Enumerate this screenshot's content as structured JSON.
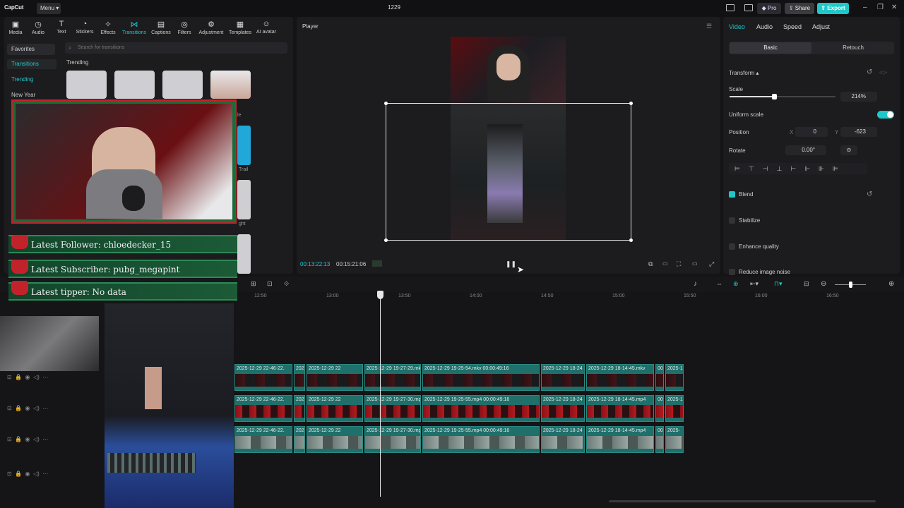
{
  "app": {
    "name": "CapCut",
    "menu_label": "Menu",
    "project_title": "1229"
  },
  "topbar": {
    "pro_label": "Pro",
    "share_label": "Share",
    "export_label": "Export"
  },
  "toolbar": {
    "items": [
      {
        "label": "Media",
        "icon": "media-icon"
      },
      {
        "label": "Audio",
        "icon": "audio-icon"
      },
      {
        "label": "Text",
        "icon": "text-icon"
      },
      {
        "label": "Stickers",
        "icon": "stickers-icon"
      },
      {
        "label": "Effects",
        "icon": "effects-icon"
      },
      {
        "label": "Transitions",
        "icon": "transitions-icon"
      },
      {
        "label": "Captions",
        "icon": "captions-icon"
      },
      {
        "label": "Filters",
        "icon": "filters-icon"
      },
      {
        "label": "Adjustment",
        "icon": "adjustment-icon"
      },
      {
        "label": "Templates",
        "icon": "templates-icon"
      },
      {
        "label": "AI avatar",
        "icon": "ai-avatar-icon"
      }
    ],
    "active_index": 5
  },
  "library": {
    "favorites": "Favorites",
    "transitions": "Transitions",
    "trending": "Trending",
    "new_year": "New Year",
    "search_placeholder": "Search for transitions",
    "section_title": "Trending",
    "partial_labels": [
      "le",
      "Trail",
      "ght"
    ]
  },
  "player": {
    "title": "Player",
    "current_time": "00:13:22:13",
    "total_time": "00:15:21:06"
  },
  "inspector": {
    "tabs": [
      "Video",
      "Audio",
      "Speed",
      "Adjust"
    ],
    "active_tab": 0,
    "segment": {
      "basic": "Basic",
      "retouch": "Retouch"
    },
    "transform_label": "Transform",
    "scale_label": "Scale",
    "scale_value": "214%",
    "scale_fraction": 0.42,
    "uniform_scale_label": "Uniform scale",
    "position_label": "Position",
    "pos_x_label": "X",
    "pos_x": "0",
    "pos_y_label": "Y",
    "pos_y": "-623",
    "rotate_label": "Rotate",
    "rotate_value": "0.00°",
    "blend_label": "Blend",
    "stabilize_label": "Stabilize",
    "enhance_label": "Enhance quality",
    "reduce_noise_label": "Reduce image noise"
  },
  "timeline": {
    "ruler": [
      "12:50",
      "13:00",
      "13:50",
      "14:00",
      "14:50",
      "15:00",
      "15:50",
      "16:00",
      "16:50"
    ],
    "tracks": [
      {
        "clips": [
          {
            "label": "2025-12-29 22-46-22.",
            "film": "dark"
          },
          {
            "label": "202",
            "film": "dark"
          },
          {
            "label": "2025-12-29 22",
            "film": "dark"
          },
          {
            "label": "2025-12-29 19-27-29.mk",
            "film": "dark"
          },
          {
            "label": "2025-12-29 19-25-54.mkv  00:00:49:16",
            "film": "dark"
          },
          {
            "label": "2025-12-29 18-24",
            "film": "dark"
          },
          {
            "label": "2025-12-29 18-14-45.mkv",
            "film": "dark"
          },
          {
            "label": "00",
            "film": "dark"
          },
          {
            "label": "2025-1",
            "film": "dark"
          }
        ]
      },
      {
        "clips": [
          {
            "label": "2025-12-29 22-46-22.",
            "film": "red"
          },
          {
            "label": "202",
            "film": "red"
          },
          {
            "label": "2025-12-29 22",
            "film": "red"
          },
          {
            "label": "2025-12-29 19-27-30.mp",
            "film": "red"
          },
          {
            "label": "2025-12-29 19-25-55.mp4  00:00:49:16",
            "film": "red"
          },
          {
            "label": "2025-12-29 18-24",
            "film": "red"
          },
          {
            "label": "2025-12-29 18-14-45.mp4",
            "film": "red"
          },
          {
            "label": "00",
            "film": "red"
          },
          {
            "label": "2025-1",
            "film": "red"
          }
        ]
      },
      {
        "clips": [
          {
            "label": "2025-12-29 22-46-22.",
            "film": "game"
          },
          {
            "label": "202",
            "film": "game"
          },
          {
            "label": "2025-12-29 22",
            "film": "game"
          },
          {
            "label": "2025-12-29 19-27-30.mp",
            "film": "game"
          },
          {
            "label": "2025-12-29 19-25-55.mp4  00:00:49:16",
            "film": "game"
          },
          {
            "label": "2025-12-29 18-24",
            "film": "game"
          },
          {
            "label": "2025-12-29 18-14-45.mp4",
            "film": "game"
          },
          {
            "label": "00",
            "film": "game"
          },
          {
            "label": "2025-",
            "film": "game"
          }
        ]
      }
    ]
  },
  "stream_overlay": {
    "latest_follower": "Latest Follower: chloedecker_15",
    "latest_subscriber": "Latest Subscriber: pubg_megapint",
    "latest_tipper": "Latest tipper: No data"
  },
  "colors": {
    "accent": "#1fc8c8",
    "clip": "#1f6f6a",
    "alert_green": "#1c5b37",
    "alert_red": "#c2232b"
  }
}
